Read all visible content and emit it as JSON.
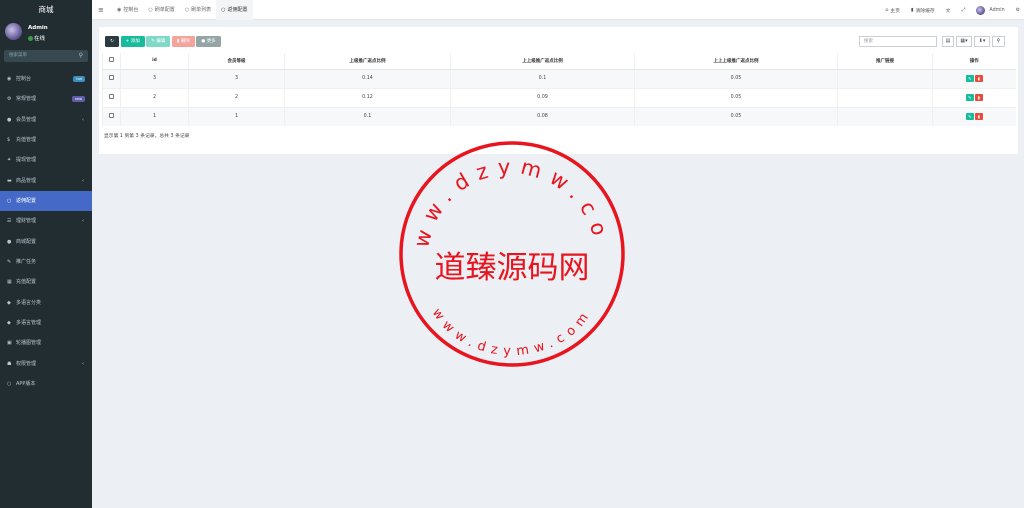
{
  "sidebar": {
    "brand": "商城",
    "user": {
      "name": "Admin",
      "status": "在线"
    },
    "search_placeholder": "搜索菜单",
    "items": [
      {
        "label": "控制台",
        "icon": "dashboard-icon",
        "glyph": "◉",
        "badge": "hot",
        "badge_color": "#3c8dbc",
        "chevron": false,
        "active": false
      },
      {
        "label": "常规管理",
        "icon": "cogs-icon",
        "glyph": "⚙",
        "badge": "new",
        "badge_color": "#605ca8",
        "chevron": false,
        "active": false
      },
      {
        "label": "会员管理",
        "icon": "user-circle-icon",
        "glyph": "●",
        "badge": "",
        "chevron": true,
        "active": false
      },
      {
        "label": "充值管理",
        "icon": "dollar-icon",
        "glyph": "$",
        "badge": "",
        "chevron": false,
        "active": false
      },
      {
        "label": "提现管理",
        "icon": "sign-icon",
        "glyph": "✦",
        "badge": "",
        "chevron": false,
        "active": false
      },
      {
        "label": "商品管理",
        "icon": "cart-icon",
        "glyph": "▬",
        "badge": "",
        "chevron": true,
        "active": false
      },
      {
        "label": "返佣配置",
        "icon": "circle-icon",
        "glyph": "○",
        "badge": "",
        "chevron": false,
        "active": true
      },
      {
        "label": "理财管理",
        "icon": "list-icon",
        "glyph": "☰",
        "badge": "",
        "chevron": true,
        "active": false
      },
      {
        "label": "商城配置",
        "icon": "circle-solid-icon",
        "glyph": "●",
        "badge": "",
        "chevron": false,
        "active": false
      },
      {
        "label": "推广任务",
        "icon": "pencil-icon",
        "glyph": "✎",
        "badge": "",
        "chevron": false,
        "active": false
      },
      {
        "label": "充值配置",
        "icon": "table-icon",
        "glyph": "▦",
        "badge": "",
        "chevron": false,
        "active": false
      },
      {
        "label": "多语言分类",
        "icon": "tag-icon",
        "glyph": "◆",
        "badge": "",
        "chevron": false,
        "active": false
      },
      {
        "label": "多语言管理",
        "icon": "tag-icon",
        "glyph": "◆",
        "badge": "",
        "chevron": false,
        "active": false
      },
      {
        "label": "轮播图管理",
        "icon": "image-icon",
        "glyph": "▣",
        "badge": "",
        "chevron": false,
        "active": false
      },
      {
        "label": "权限管理",
        "icon": "group-icon",
        "glyph": "☗",
        "badge": "",
        "chevron": true,
        "active": false
      },
      {
        "label": "APP版本",
        "icon": "circle-icon",
        "glyph": "○",
        "badge": "",
        "chevron": false,
        "active": false
      }
    ]
  },
  "topbar": {
    "tabs": [
      {
        "label": "控制台",
        "icon": "dashboard-icon",
        "glyph": "◉"
      },
      {
        "label": "刷单配置",
        "icon": "circle-icon",
        "glyph": "○"
      },
      {
        "label": "刷单列表",
        "icon": "circle-icon",
        "glyph": "○"
      },
      {
        "label": "返佣配置",
        "icon": "circle-icon",
        "glyph": "○"
      }
    ],
    "home_label": "主页",
    "clear_cache_label": "清除缓存",
    "user_name": "Admin"
  },
  "toolbar": {
    "add_label": "添加",
    "edit_label": "编辑",
    "delete_label": "删除",
    "more_label": "更多",
    "search_placeholder": "搜索"
  },
  "table": {
    "columns": [
      "id",
      "会员等级",
      "上级推广返点比例",
      "上上级推广返点比例",
      "上上上级推广返点比例",
      "推广链接",
      "操作"
    ],
    "rows": [
      {
        "id": "3",
        "level": "3",
        "r1": "0.14",
        "r2": "0.1",
        "r3": "0.05",
        "link": ""
      },
      {
        "id": "2",
        "level": "2",
        "r1": "0.12",
        "r2": "0.09",
        "r3": "0.05",
        "link": ""
      },
      {
        "id": "1",
        "level": "1",
        "r1": "0.1",
        "r2": "0.08",
        "r3": "0.05",
        "link": ""
      }
    ],
    "footer": "显示第 1 到第 3 条记录，总共 3 条记录"
  },
  "watermark": {
    "center_text": "道臻源码网",
    "top_arc": "www.dzymw.com",
    "bottom_arc": "www.dzymw.com",
    "color": "#e8141e"
  }
}
